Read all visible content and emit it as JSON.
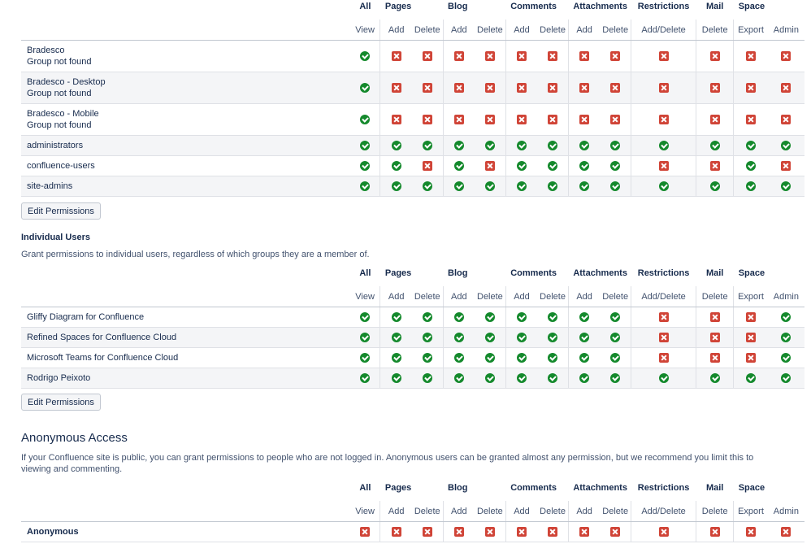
{
  "headers": {
    "top": [
      "All",
      "Pages",
      "Blog",
      "Comments",
      "Attachments",
      "Restrictions",
      "Mail",
      "Space"
    ],
    "sub": [
      "View",
      "Add",
      "Delete",
      "Add",
      "Delete",
      "Add",
      "Delete",
      "Add",
      "Delete",
      "Add/Delete",
      "Delete",
      "Export",
      "Admin"
    ]
  },
  "groups": {
    "rows": [
      {
        "name": "Bradesco",
        "sub": "Group not found",
        "perms": [
          1,
          0,
          0,
          0,
          0,
          0,
          0,
          0,
          0,
          0,
          0,
          0,
          0
        ]
      },
      {
        "name": "Bradesco - Desktop",
        "sub": "Group not found",
        "perms": [
          1,
          0,
          0,
          0,
          0,
          0,
          0,
          0,
          0,
          0,
          0,
          0,
          0
        ]
      },
      {
        "name": "Bradesco - Mobile",
        "sub": "Group not found",
        "perms": [
          1,
          0,
          0,
          0,
          0,
          0,
          0,
          0,
          0,
          0,
          0,
          0,
          0
        ]
      },
      {
        "name": "administrators",
        "perms": [
          1,
          1,
          1,
          1,
          1,
          1,
          1,
          1,
          1,
          1,
          1,
          1,
          1
        ]
      },
      {
        "name": "confluence-users",
        "perms": [
          1,
          1,
          0,
          1,
          0,
          1,
          1,
          1,
          1,
          0,
          0,
          1,
          0
        ]
      },
      {
        "name": "site-admins",
        "perms": [
          1,
          1,
          1,
          1,
          1,
          1,
          1,
          1,
          1,
          1,
          1,
          1,
          1
        ]
      }
    ],
    "edit_label": "Edit Permissions"
  },
  "individual": {
    "title": "Individual Users",
    "description": "Grant permissions to individual users, regardless of which groups they are a member of.",
    "rows": [
      {
        "name": "Gliffy Diagram for Confluence",
        "perms": [
          1,
          1,
          1,
          1,
          1,
          1,
          1,
          1,
          1,
          0,
          0,
          0,
          1
        ]
      },
      {
        "name": "Refined Spaces for Confluence Cloud",
        "perms": [
          1,
          1,
          1,
          1,
          1,
          1,
          1,
          1,
          1,
          0,
          0,
          0,
          1
        ]
      },
      {
        "name": "Microsoft Teams for Confluence Cloud",
        "perms": [
          1,
          1,
          1,
          1,
          1,
          1,
          1,
          1,
          1,
          0,
          0,
          0,
          1
        ]
      },
      {
        "name": "Rodrigo Peixoto",
        "perms": [
          1,
          1,
          1,
          1,
          1,
          1,
          1,
          1,
          1,
          1,
          1,
          1,
          1
        ]
      }
    ],
    "edit_label": "Edit Permissions"
  },
  "anonymous": {
    "title": "Anonymous Access",
    "description": "If your Confluence site is public, you can grant permissions to people who are not logged in. Anonymous users can be granted almost any permission, but we recommend you limit this to viewing and commenting.",
    "rows": [
      {
        "name": "Anonymous",
        "perms": [
          0,
          0,
          0,
          0,
          0,
          0,
          0,
          0,
          0,
          0,
          0,
          0,
          0
        ]
      }
    ]
  },
  "colors": {
    "granted": "#14892c",
    "denied": "#d04437",
    "text": "#172b4d",
    "alt_row": "#f4f5f7"
  },
  "icons": {
    "granted": "check-circle-icon",
    "denied": "cross-square-icon"
  }
}
